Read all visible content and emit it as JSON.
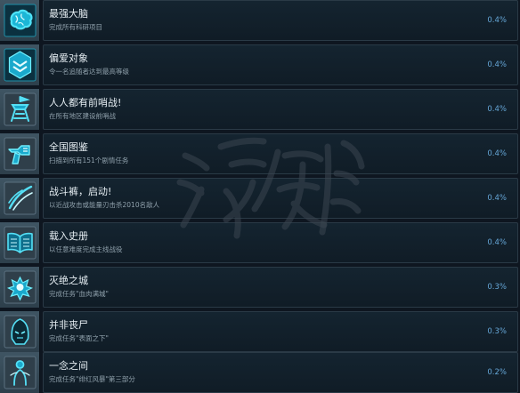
{
  "achievements": [
    {
      "title": "最强大脑",
      "description": "完成所有科研项目",
      "percent": "0.4%",
      "icon": "brain-icon"
    },
    {
      "title": "偏爱对象",
      "description": "令一名追随者达到最高等级",
      "percent": "0.4%",
      "icon": "rank-chevron-icon"
    },
    {
      "title": "人人都有前哨战!",
      "description": "在所有地区建设前哨战",
      "percent": "0.4%",
      "icon": "outpost-tower-icon"
    },
    {
      "title": "全国图鉴",
      "description": "扫描到所有151个剧情任务",
      "percent": "0.4%",
      "icon": "scanner-icon"
    },
    {
      "title": "战斗裤，启动!",
      "description": "以近战攻击或能量刃击杀2010名敌人",
      "percent": "0.4%",
      "icon": "blade-slash-icon"
    },
    {
      "title": "载入史册",
      "description": "以任意难度完成主线战役",
      "percent": "0.4%",
      "icon": "open-book-icon"
    },
    {
      "title": "灭绝之城",
      "description": "完成任务\"血肉满城\"",
      "percent": "0.3%",
      "icon": "splatter-icon"
    },
    {
      "title": "并非丧尸",
      "description": "完成任务\"表面之下\"",
      "percent": "0.3%",
      "icon": "hooded-alien-icon"
    },
    {
      "title": "一念之间",
      "description": "完成任务\"绯红风暴\"第三部分",
      "percent": "0.2%",
      "icon": "figure-silhouette-icon"
    }
  ],
  "watermark": {
    "text": "游侠网"
  },
  "colors": {
    "accent": "#66a7d8",
    "icon_glow": "#33d6f0",
    "panel": "#121e28",
    "background": "#0e1620"
  }
}
